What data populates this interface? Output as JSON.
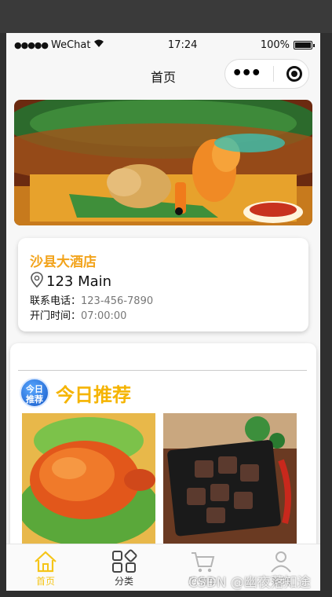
{
  "status": {
    "carrier": "WeChat",
    "time": "17:24",
    "battery": "100%"
  },
  "nav": {
    "title": "首页"
  },
  "shop": {
    "name": "沙县大酒店",
    "address": "123 Main",
    "phone_label": "联系电话：",
    "phone": "123-456-7890",
    "hours_label": "开门时间：",
    "hours": "07:00:00"
  },
  "recommend": {
    "badge_line1": "今日",
    "badge_line2": "推荐",
    "title": "今日推荐"
  },
  "tabs": [
    {
      "label": "首页",
      "icon": "home-icon"
    },
    {
      "label": "分类",
      "icon": "grid-icon"
    },
    {
      "label": "购物车",
      "icon": "cart-icon"
    },
    {
      "label": "我的",
      "icon": "user-icon"
    }
  ],
  "watermark": "CSDN @幽夜落知途",
  "colors": {
    "accent": "#f5c518",
    "shop_name": "#f2a31a"
  }
}
